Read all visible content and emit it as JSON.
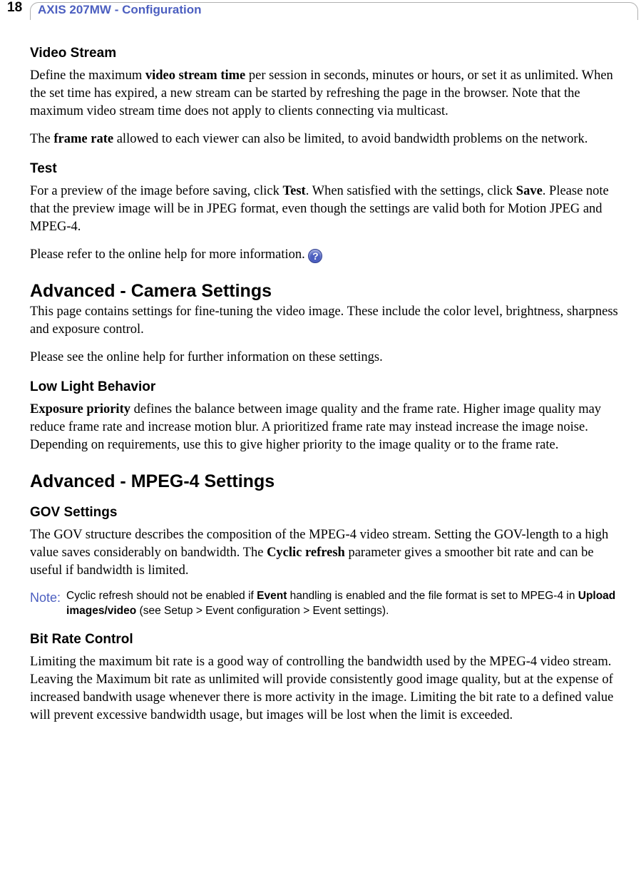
{
  "header": {
    "page_number": "18",
    "tab_title": "AXIS 207MW - Configuration"
  },
  "sections": {
    "video_stream": {
      "title": "Video Stream",
      "p1_pre": "Define the maximum ",
      "p1_bold": "video stream time",
      "p1_post": " per session in seconds, minutes or hours, or set it as unlimited. When the set time has expired, a new stream can be started by refreshing the page in the browser. Note that the maximum video stream time does not apply to clients connecting via multicast.",
      "p2_pre": "The ",
      "p2_bold": "frame rate",
      "p2_post": " allowed to each viewer can also be limited, to avoid bandwidth problems on the network."
    },
    "test": {
      "title": "Test",
      "p1_pre": "For a preview of the image before saving, click ",
      "p1_b1": "Test",
      "p1_mid": ". When satisfied with the settings, click ",
      "p1_b2": "Save",
      "p1_post": ". Please note that the preview image will be in JPEG format, even though the settings are valid both for Motion JPEG and MPEG-4.",
      "p2": "Please refer to the online help for more information. "
    },
    "adv_camera": {
      "title": "Advanced - Camera Settings",
      "p1": "This page contains settings for fine-tuning the video image. These include the color level, brightness, sharpness and exposure control.",
      "p2": "Please see the online help for further information on these settings."
    },
    "low_light": {
      "title": "Low Light Behavior",
      "p1_bold": "Exposure priority",
      "p1_post": " defines the balance between image quality and the frame rate. Higher image quality may reduce frame rate and increase motion blur. A prioritized frame rate may instead increase the image noise. Depending on requirements, use this to give higher priority to the image quality or to the frame rate."
    },
    "adv_mpeg4": {
      "title": "Advanced - MPEG-4 Settings"
    },
    "gov": {
      "title": "GOV Settings",
      "p1_pre": "The GOV structure describes the composition of the MPEG-4 video stream. Setting the GOV-length to a high value saves considerably on bandwidth. The ",
      "p1_bold": "Cyclic refresh",
      "p1_post": " parameter gives a smoother bit rate and can be useful if bandwidth is limited."
    },
    "note": {
      "label": "Note:",
      "body_pre": "Cyclic refresh should not be enabled if ",
      "body_b1": "Event",
      "body_mid": " handling is enabled and the file format is set to MPEG-4 in ",
      "body_b2": "Upload images/video",
      "body_post": " (see Setup > Event configuration > Event settings)."
    },
    "bitrate": {
      "title": "Bit Rate Control",
      "p1": "Limiting the maximum bit rate is a good way of controlling the bandwidth used by the MPEG-4 video stream. Leaving the Maximum bit rate as unlimited will provide consistently good image quality, but at the expense of increased bandwith usage whenever there is more activity in the image. Limiting the bit rate to a defined value will prevent excessive bandwidth usage, but images will be lost when the limit is exceeded."
    }
  },
  "icons": {
    "help": "?"
  }
}
